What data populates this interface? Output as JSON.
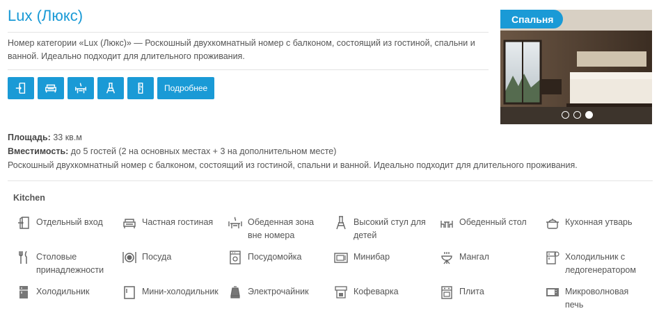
{
  "room": {
    "title": "Lux (Люкс)",
    "description": "Номер категории «Lux (Люкс)» — Роскошный двухкомнатный номер с балконом, состоящий из гостиной, спальни и ванной. Идеально подходит для длительного проживания.",
    "more_label": "Подробнее",
    "icon_buttons": [
      "door-entry-icon",
      "sofa-icon",
      "dining-icon",
      "high-chair-icon",
      "fridge-icon"
    ]
  },
  "photo": {
    "caption": "Спальня",
    "slides": 3,
    "active_slide": 3
  },
  "details": {
    "area_label": "Площадь:",
    "area_value": "33 кв.м",
    "capacity_label": "Вместимость:",
    "capacity_value": "до 5 гостей (2 на основных местах + 3 на дополнительном месте)",
    "summary": "Роскошный двухкомнатный номер с балконом, состоящий из гостиной, спальни и ванной. Идеально подходит для длительного проживания."
  },
  "kitchen": {
    "heading": "Kitchen",
    "items": [
      {
        "label": "Отдельный вход",
        "icon": "door-entry-icon"
      },
      {
        "label": "Частная гостиная",
        "icon": "sofa-icon"
      },
      {
        "label": "Обеденная зона вне номера",
        "icon": "dining-area-icon"
      },
      {
        "label": "Высокий стул для детей",
        "icon": "high-chair-icon"
      },
      {
        "label": "Обеденный стол",
        "icon": "dining-table-icon"
      },
      {
        "label": "Кухонная утварь",
        "icon": "cookware-icon"
      },
      {
        "label": "Столовые принадлежности",
        "icon": "cutlery-icon"
      },
      {
        "label": "Посуда",
        "icon": "plate-icon"
      },
      {
        "label": "Посудомойка",
        "icon": "dishwasher-icon"
      },
      {
        "label": "Минибар",
        "icon": "minibar-icon"
      },
      {
        "label": "Мангал",
        "icon": "grill-icon"
      },
      {
        "label": "Холодильник с ледогенератором",
        "icon": "ice-fridge-icon"
      },
      {
        "label": "Холодильник",
        "icon": "fridge-icon"
      },
      {
        "label": "Мини-холодильник",
        "icon": "mini-fridge-icon"
      },
      {
        "label": "Электрочайник",
        "icon": "kettle-icon"
      },
      {
        "label": "Кофеварка",
        "icon": "coffee-maker-icon"
      },
      {
        "label": "Плита",
        "icon": "stove-icon"
      },
      {
        "label": "Микроволновая печь",
        "icon": "microwave-icon"
      }
    ]
  }
}
